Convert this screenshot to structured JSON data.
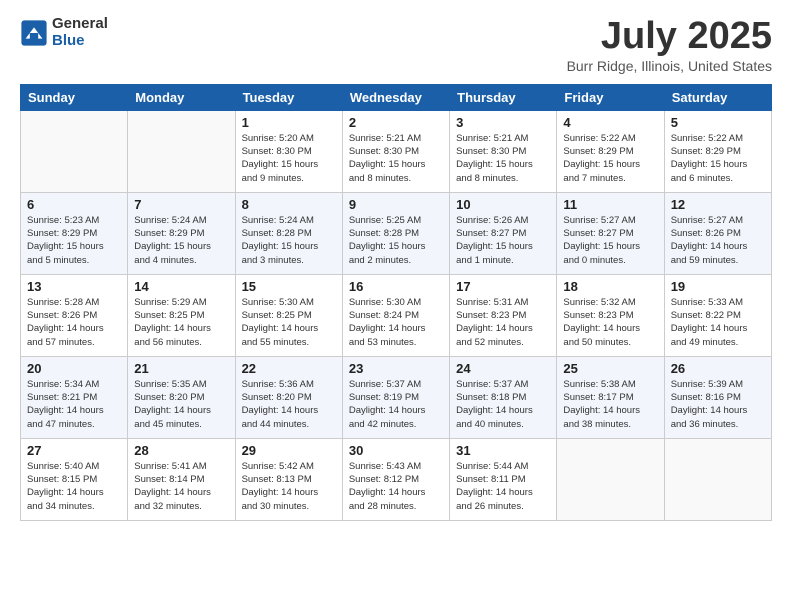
{
  "logo": {
    "general": "General",
    "blue": "Blue"
  },
  "title": "July 2025",
  "location": "Burr Ridge, Illinois, United States",
  "days_of_week": [
    "Sunday",
    "Monday",
    "Tuesday",
    "Wednesday",
    "Thursday",
    "Friday",
    "Saturday"
  ],
  "weeks": [
    [
      {
        "num": "",
        "sunrise": "",
        "sunset": "",
        "daylight": ""
      },
      {
        "num": "",
        "sunrise": "",
        "sunset": "",
        "daylight": ""
      },
      {
        "num": "1",
        "sunrise": "Sunrise: 5:20 AM",
        "sunset": "Sunset: 8:30 PM",
        "daylight": "Daylight: 15 hours and 9 minutes."
      },
      {
        "num": "2",
        "sunrise": "Sunrise: 5:21 AM",
        "sunset": "Sunset: 8:30 PM",
        "daylight": "Daylight: 15 hours and 8 minutes."
      },
      {
        "num": "3",
        "sunrise": "Sunrise: 5:21 AM",
        "sunset": "Sunset: 8:30 PM",
        "daylight": "Daylight: 15 hours and 8 minutes."
      },
      {
        "num": "4",
        "sunrise": "Sunrise: 5:22 AM",
        "sunset": "Sunset: 8:29 PM",
        "daylight": "Daylight: 15 hours and 7 minutes."
      },
      {
        "num": "5",
        "sunrise": "Sunrise: 5:22 AM",
        "sunset": "Sunset: 8:29 PM",
        "daylight": "Daylight: 15 hours and 6 minutes."
      }
    ],
    [
      {
        "num": "6",
        "sunrise": "Sunrise: 5:23 AM",
        "sunset": "Sunset: 8:29 PM",
        "daylight": "Daylight: 15 hours and 5 minutes."
      },
      {
        "num": "7",
        "sunrise": "Sunrise: 5:24 AM",
        "sunset": "Sunset: 8:29 PM",
        "daylight": "Daylight: 15 hours and 4 minutes."
      },
      {
        "num": "8",
        "sunrise": "Sunrise: 5:24 AM",
        "sunset": "Sunset: 8:28 PM",
        "daylight": "Daylight: 15 hours and 3 minutes."
      },
      {
        "num": "9",
        "sunrise": "Sunrise: 5:25 AM",
        "sunset": "Sunset: 8:28 PM",
        "daylight": "Daylight: 15 hours and 2 minutes."
      },
      {
        "num": "10",
        "sunrise": "Sunrise: 5:26 AM",
        "sunset": "Sunset: 8:27 PM",
        "daylight": "Daylight: 15 hours and 1 minute."
      },
      {
        "num": "11",
        "sunrise": "Sunrise: 5:27 AM",
        "sunset": "Sunset: 8:27 PM",
        "daylight": "Daylight: 15 hours and 0 minutes."
      },
      {
        "num": "12",
        "sunrise": "Sunrise: 5:27 AM",
        "sunset": "Sunset: 8:26 PM",
        "daylight": "Daylight: 14 hours and 59 minutes."
      }
    ],
    [
      {
        "num": "13",
        "sunrise": "Sunrise: 5:28 AM",
        "sunset": "Sunset: 8:26 PM",
        "daylight": "Daylight: 14 hours and 57 minutes."
      },
      {
        "num": "14",
        "sunrise": "Sunrise: 5:29 AM",
        "sunset": "Sunset: 8:25 PM",
        "daylight": "Daylight: 14 hours and 56 minutes."
      },
      {
        "num": "15",
        "sunrise": "Sunrise: 5:30 AM",
        "sunset": "Sunset: 8:25 PM",
        "daylight": "Daylight: 14 hours and 55 minutes."
      },
      {
        "num": "16",
        "sunrise": "Sunrise: 5:30 AM",
        "sunset": "Sunset: 8:24 PM",
        "daylight": "Daylight: 14 hours and 53 minutes."
      },
      {
        "num": "17",
        "sunrise": "Sunrise: 5:31 AM",
        "sunset": "Sunset: 8:23 PM",
        "daylight": "Daylight: 14 hours and 52 minutes."
      },
      {
        "num": "18",
        "sunrise": "Sunrise: 5:32 AM",
        "sunset": "Sunset: 8:23 PM",
        "daylight": "Daylight: 14 hours and 50 minutes."
      },
      {
        "num": "19",
        "sunrise": "Sunrise: 5:33 AM",
        "sunset": "Sunset: 8:22 PM",
        "daylight": "Daylight: 14 hours and 49 minutes."
      }
    ],
    [
      {
        "num": "20",
        "sunrise": "Sunrise: 5:34 AM",
        "sunset": "Sunset: 8:21 PM",
        "daylight": "Daylight: 14 hours and 47 minutes."
      },
      {
        "num": "21",
        "sunrise": "Sunrise: 5:35 AM",
        "sunset": "Sunset: 8:20 PM",
        "daylight": "Daylight: 14 hours and 45 minutes."
      },
      {
        "num": "22",
        "sunrise": "Sunrise: 5:36 AM",
        "sunset": "Sunset: 8:20 PM",
        "daylight": "Daylight: 14 hours and 44 minutes."
      },
      {
        "num": "23",
        "sunrise": "Sunrise: 5:37 AM",
        "sunset": "Sunset: 8:19 PM",
        "daylight": "Daylight: 14 hours and 42 minutes."
      },
      {
        "num": "24",
        "sunrise": "Sunrise: 5:37 AM",
        "sunset": "Sunset: 8:18 PM",
        "daylight": "Daylight: 14 hours and 40 minutes."
      },
      {
        "num": "25",
        "sunrise": "Sunrise: 5:38 AM",
        "sunset": "Sunset: 8:17 PM",
        "daylight": "Daylight: 14 hours and 38 minutes."
      },
      {
        "num": "26",
        "sunrise": "Sunrise: 5:39 AM",
        "sunset": "Sunset: 8:16 PM",
        "daylight": "Daylight: 14 hours and 36 minutes."
      }
    ],
    [
      {
        "num": "27",
        "sunrise": "Sunrise: 5:40 AM",
        "sunset": "Sunset: 8:15 PM",
        "daylight": "Daylight: 14 hours and 34 minutes."
      },
      {
        "num": "28",
        "sunrise": "Sunrise: 5:41 AM",
        "sunset": "Sunset: 8:14 PM",
        "daylight": "Daylight: 14 hours and 32 minutes."
      },
      {
        "num": "29",
        "sunrise": "Sunrise: 5:42 AM",
        "sunset": "Sunset: 8:13 PM",
        "daylight": "Daylight: 14 hours and 30 minutes."
      },
      {
        "num": "30",
        "sunrise": "Sunrise: 5:43 AM",
        "sunset": "Sunset: 8:12 PM",
        "daylight": "Daylight: 14 hours and 28 minutes."
      },
      {
        "num": "31",
        "sunrise": "Sunrise: 5:44 AM",
        "sunset": "Sunset: 8:11 PM",
        "daylight": "Daylight: 14 hours and 26 minutes."
      },
      {
        "num": "",
        "sunrise": "",
        "sunset": "",
        "daylight": ""
      },
      {
        "num": "",
        "sunrise": "",
        "sunset": "",
        "daylight": ""
      }
    ]
  ]
}
